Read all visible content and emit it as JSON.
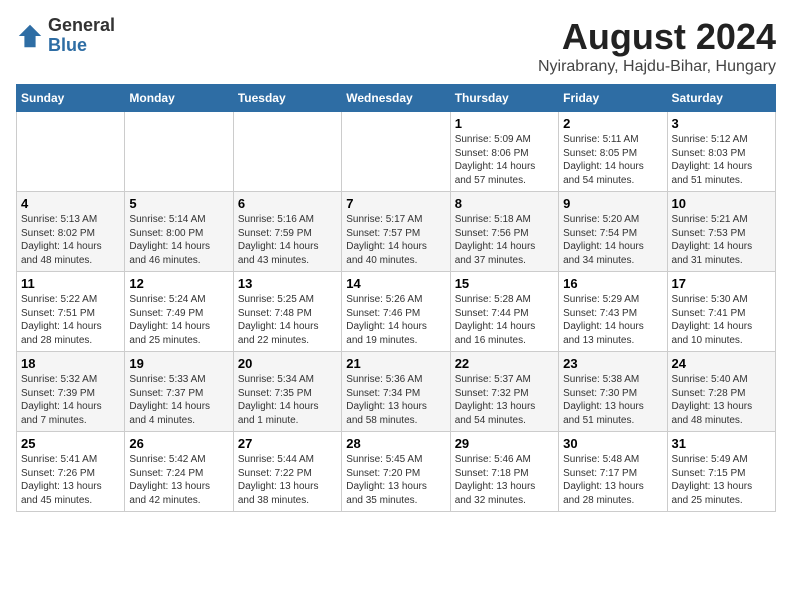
{
  "header": {
    "logo_general": "General",
    "logo_blue": "Blue",
    "month_year": "August 2024",
    "location": "Nyirabrany, Hajdu-Bihar, Hungary"
  },
  "days_of_week": [
    "Sunday",
    "Monday",
    "Tuesday",
    "Wednesday",
    "Thursday",
    "Friday",
    "Saturday"
  ],
  "weeks": [
    [
      {
        "day": "",
        "sunrise": "",
        "sunset": "",
        "daylight": ""
      },
      {
        "day": "",
        "sunrise": "",
        "sunset": "",
        "daylight": ""
      },
      {
        "day": "",
        "sunrise": "",
        "sunset": "",
        "daylight": ""
      },
      {
        "day": "",
        "sunrise": "",
        "sunset": "",
        "daylight": ""
      },
      {
        "day": "1",
        "sunrise": "5:09 AM",
        "sunset": "8:06 PM",
        "daylight": "14 hours and 57 minutes."
      },
      {
        "day": "2",
        "sunrise": "5:11 AM",
        "sunset": "8:05 PM",
        "daylight": "14 hours and 54 minutes."
      },
      {
        "day": "3",
        "sunrise": "5:12 AM",
        "sunset": "8:03 PM",
        "daylight": "14 hours and 51 minutes."
      }
    ],
    [
      {
        "day": "4",
        "sunrise": "5:13 AM",
        "sunset": "8:02 PM",
        "daylight": "14 hours and 48 minutes."
      },
      {
        "day": "5",
        "sunrise": "5:14 AM",
        "sunset": "8:00 PM",
        "daylight": "14 hours and 46 minutes."
      },
      {
        "day": "6",
        "sunrise": "5:16 AM",
        "sunset": "7:59 PM",
        "daylight": "14 hours and 43 minutes."
      },
      {
        "day": "7",
        "sunrise": "5:17 AM",
        "sunset": "7:57 PM",
        "daylight": "14 hours and 40 minutes."
      },
      {
        "day": "8",
        "sunrise": "5:18 AM",
        "sunset": "7:56 PM",
        "daylight": "14 hours and 37 minutes."
      },
      {
        "day": "9",
        "sunrise": "5:20 AM",
        "sunset": "7:54 PM",
        "daylight": "14 hours and 34 minutes."
      },
      {
        "day": "10",
        "sunrise": "5:21 AM",
        "sunset": "7:53 PM",
        "daylight": "14 hours and 31 minutes."
      }
    ],
    [
      {
        "day": "11",
        "sunrise": "5:22 AM",
        "sunset": "7:51 PM",
        "daylight": "14 hours and 28 minutes."
      },
      {
        "day": "12",
        "sunrise": "5:24 AM",
        "sunset": "7:49 PM",
        "daylight": "14 hours and 25 minutes."
      },
      {
        "day": "13",
        "sunrise": "5:25 AM",
        "sunset": "7:48 PM",
        "daylight": "14 hours and 22 minutes."
      },
      {
        "day": "14",
        "sunrise": "5:26 AM",
        "sunset": "7:46 PM",
        "daylight": "14 hours and 19 minutes."
      },
      {
        "day": "15",
        "sunrise": "5:28 AM",
        "sunset": "7:44 PM",
        "daylight": "14 hours and 16 minutes."
      },
      {
        "day": "16",
        "sunrise": "5:29 AM",
        "sunset": "7:43 PM",
        "daylight": "14 hours and 13 minutes."
      },
      {
        "day": "17",
        "sunrise": "5:30 AM",
        "sunset": "7:41 PM",
        "daylight": "14 hours and 10 minutes."
      }
    ],
    [
      {
        "day": "18",
        "sunrise": "5:32 AM",
        "sunset": "7:39 PM",
        "daylight": "14 hours and 7 minutes."
      },
      {
        "day": "19",
        "sunrise": "5:33 AM",
        "sunset": "7:37 PM",
        "daylight": "14 hours and 4 minutes."
      },
      {
        "day": "20",
        "sunrise": "5:34 AM",
        "sunset": "7:35 PM",
        "daylight": "14 hours and 1 minute."
      },
      {
        "day": "21",
        "sunrise": "5:36 AM",
        "sunset": "7:34 PM",
        "daylight": "13 hours and 58 minutes."
      },
      {
        "day": "22",
        "sunrise": "5:37 AM",
        "sunset": "7:32 PM",
        "daylight": "13 hours and 54 minutes."
      },
      {
        "day": "23",
        "sunrise": "5:38 AM",
        "sunset": "7:30 PM",
        "daylight": "13 hours and 51 minutes."
      },
      {
        "day": "24",
        "sunrise": "5:40 AM",
        "sunset": "7:28 PM",
        "daylight": "13 hours and 48 minutes."
      }
    ],
    [
      {
        "day": "25",
        "sunrise": "5:41 AM",
        "sunset": "7:26 PM",
        "daylight": "13 hours and 45 minutes."
      },
      {
        "day": "26",
        "sunrise": "5:42 AM",
        "sunset": "7:24 PM",
        "daylight": "13 hours and 42 minutes."
      },
      {
        "day": "27",
        "sunrise": "5:44 AM",
        "sunset": "7:22 PM",
        "daylight": "13 hours and 38 minutes."
      },
      {
        "day": "28",
        "sunrise": "5:45 AM",
        "sunset": "7:20 PM",
        "daylight": "13 hours and 35 minutes."
      },
      {
        "day": "29",
        "sunrise": "5:46 AM",
        "sunset": "7:18 PM",
        "daylight": "13 hours and 32 minutes."
      },
      {
        "day": "30",
        "sunrise": "5:48 AM",
        "sunset": "7:17 PM",
        "daylight": "13 hours and 28 minutes."
      },
      {
        "day": "31",
        "sunrise": "5:49 AM",
        "sunset": "7:15 PM",
        "daylight": "13 hours and 25 minutes."
      }
    ]
  ]
}
